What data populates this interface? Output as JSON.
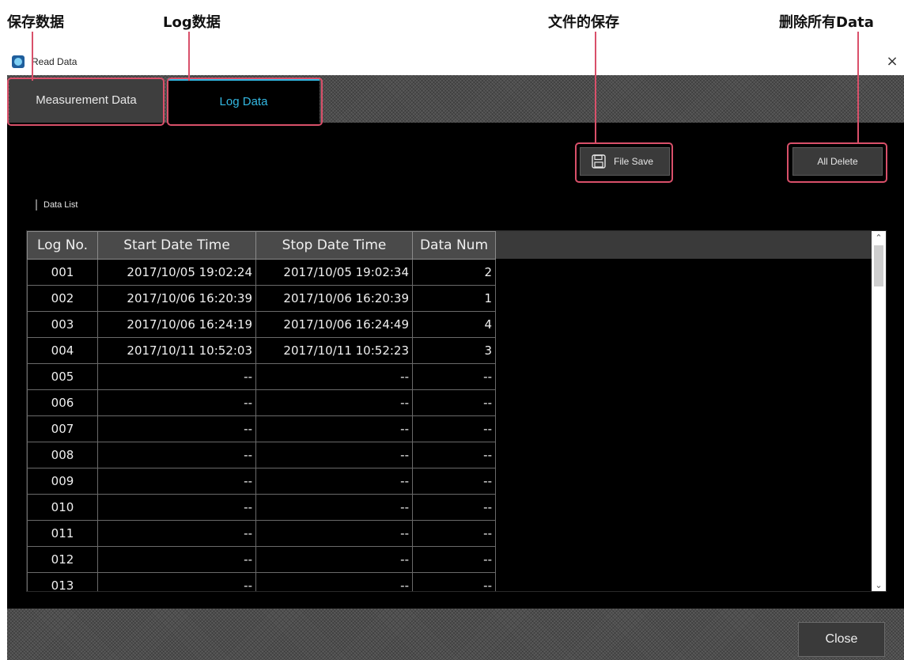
{
  "annotations": {
    "measurement_label": "保存数据",
    "log_label": "Log数据",
    "file_save_label": "文件的保存",
    "all_delete_label": "删除所有Data"
  },
  "window": {
    "title": "Read Data",
    "close_glyph": "×"
  },
  "tabs": {
    "measurement": "Measurement Data",
    "log": "Log Data",
    "active": "log"
  },
  "toolbar": {
    "file_save": "File Save",
    "all_delete": "All Delete"
  },
  "data_list": {
    "label": "Data List",
    "columns": [
      "Log No.",
      "Start Date Time",
      "Stop Date Time",
      "Data Num"
    ],
    "rows": [
      [
        "001",
        "2017/10/05 19:02:24",
        "2017/10/05 19:02:34",
        "2"
      ],
      [
        "002",
        "2017/10/06 16:20:39",
        "2017/10/06 16:20:39",
        "1"
      ],
      [
        "003",
        "2017/10/06 16:24:19",
        "2017/10/06 16:24:49",
        "4"
      ],
      [
        "004",
        "2017/10/11 10:52:03",
        "2017/10/11 10:52:23",
        "3"
      ],
      [
        "005",
        "--",
        "--",
        "--"
      ],
      [
        "006",
        "--",
        "--",
        "--"
      ],
      [
        "007",
        "--",
        "--",
        "--"
      ],
      [
        "008",
        "--",
        "--",
        "--"
      ],
      [
        "009",
        "--",
        "--",
        "--"
      ],
      [
        "010",
        "--",
        "--",
        "--"
      ],
      [
        "011",
        "--",
        "--",
        "--"
      ],
      [
        "012",
        "--",
        "--",
        "--"
      ],
      [
        "013",
        "--",
        "--",
        "--"
      ]
    ]
  },
  "footer": {
    "close": "Close"
  },
  "colors": {
    "accent": "#33b8e2",
    "highlight": "#d9506a"
  },
  "icons": {
    "file_save": "floppy-disk-icon",
    "scroll_up": "chevron-up-icon",
    "scroll_down": "chevron-down-icon"
  }
}
